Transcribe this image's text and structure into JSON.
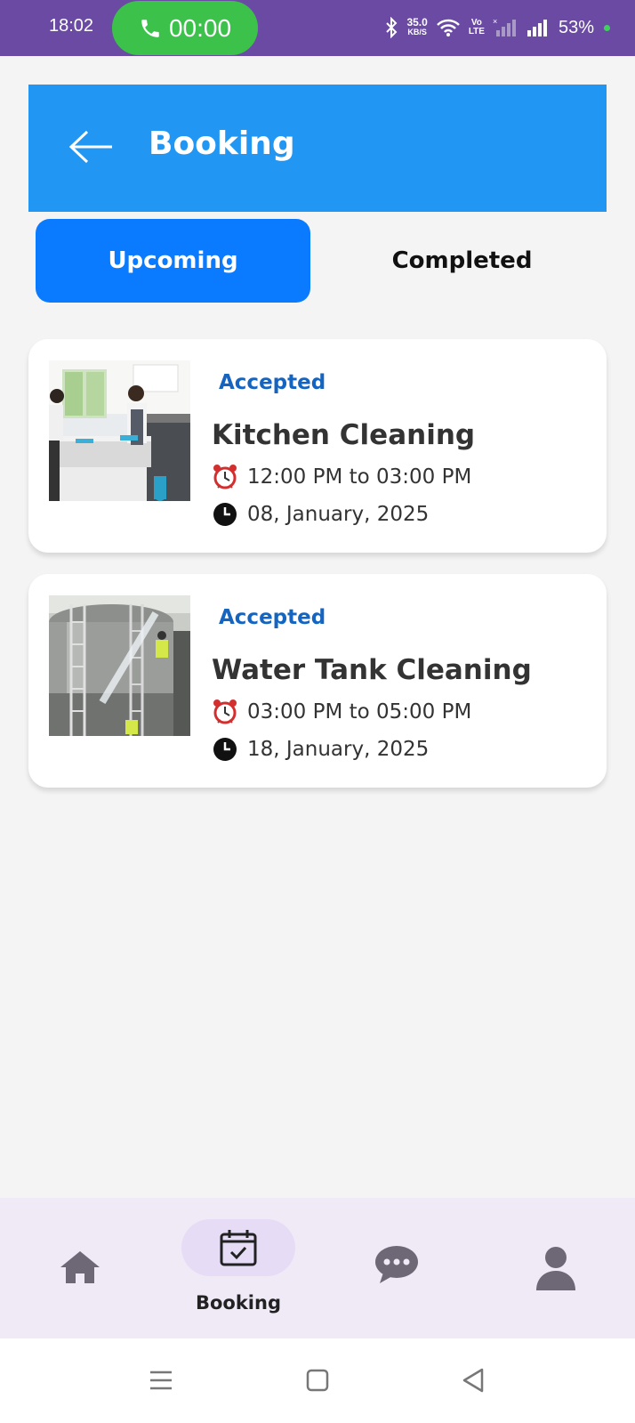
{
  "status_bar": {
    "time": "18:02",
    "call_duration": "00:00",
    "net_speed_value": "35.0",
    "net_speed_unit": "KB/S",
    "volte_top": "Vo",
    "volte_bottom": "LTE",
    "battery": "53%"
  },
  "header": {
    "title": "Booking"
  },
  "tabs": [
    {
      "label": "Upcoming",
      "active": true
    },
    {
      "label": "Completed",
      "active": false
    }
  ],
  "bookings": [
    {
      "status": "Accepted",
      "title": "Kitchen Cleaning",
      "time": "12:00 PM to 03:00 PM",
      "date": "08, January, 2025"
    },
    {
      "status": "Accepted",
      "title": "Water Tank Cleaning",
      "time": "03:00 PM to 05:00 PM",
      "date": "18, January, 2025"
    }
  ],
  "bottom_nav": {
    "items": [
      {
        "icon": "home-icon",
        "label": ""
      },
      {
        "icon": "calendar-check-icon",
        "label": "Booking",
        "active": true
      },
      {
        "icon": "chat-icon",
        "label": ""
      },
      {
        "icon": "profile-icon",
        "label": ""
      }
    ]
  },
  "colors": {
    "status_bar": "#6a4aa3",
    "header": "#2196f3",
    "active_tab": "#0a7aff",
    "status_text": "#1565c0",
    "bottom_nav": "#f0eaf7",
    "call_pill": "#3cc14a"
  }
}
